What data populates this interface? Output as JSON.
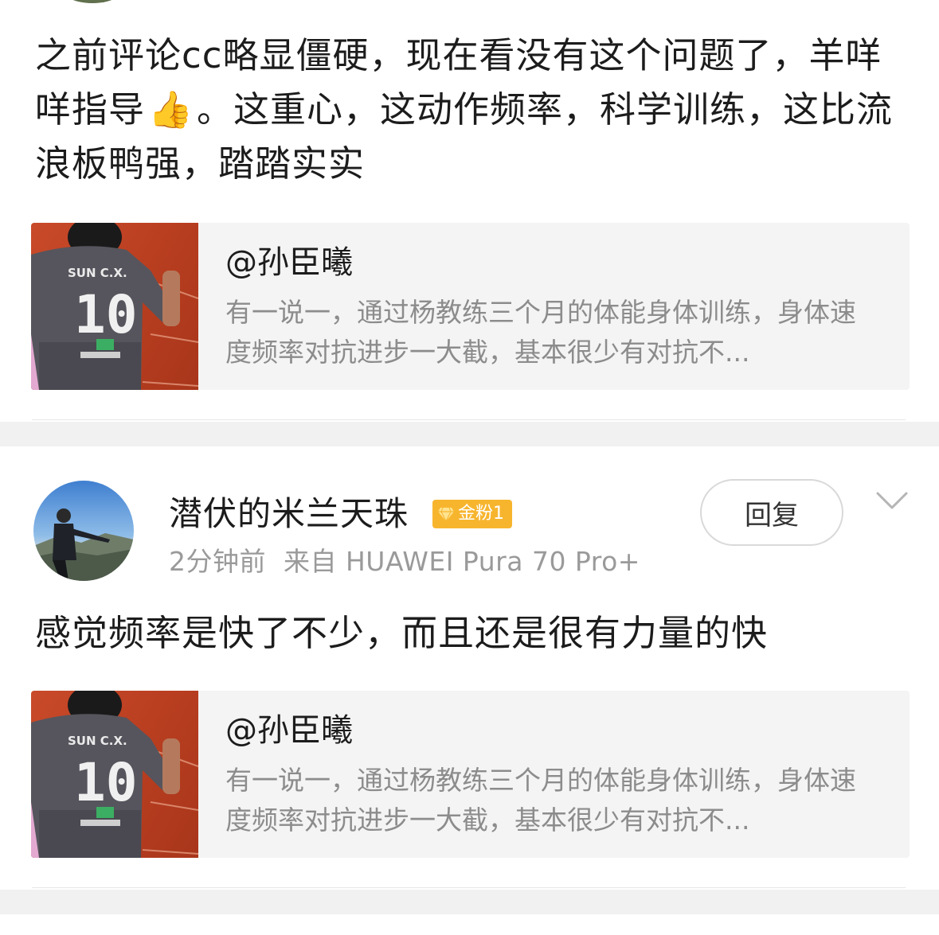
{
  "comment1": {
    "text_part1": "之前评论cc略显僵硬，现在看没有这个问题了，羊咩咩指导",
    "thumbs_emoji": "👍",
    "text_part2": "。这重心，这动作频率，科学训练，这比流浪板鸭强，踏踏实实"
  },
  "quote": {
    "author": "@孙臣曦",
    "excerpt": "有一说一，通过杨教练三个月的体能身体训练，身体速度频率对抗进步一大截，基本很少有对抗不...",
    "jersey_number": "10",
    "jersey_name": "SUN C.X."
  },
  "comment2": {
    "username": "潜伏的米兰天珠",
    "badge_label": "金粉1",
    "time": "2分钟前",
    "source": "来自 HUAWEI Pura 70 Pro+",
    "reply_label": "回复",
    "text": "感觉频率是快了不少，而且还是很有力量的快"
  },
  "colors": {
    "badge": "#f7b52e",
    "card_bg": "#f4f4f4",
    "meta_text": "#9a9a9a",
    "quote_text": "#8c8c8c"
  },
  "icons": {
    "thumbs": "thumbs-up-emoji",
    "badge": "gem-icon",
    "menu": "chevron-down-icon"
  }
}
